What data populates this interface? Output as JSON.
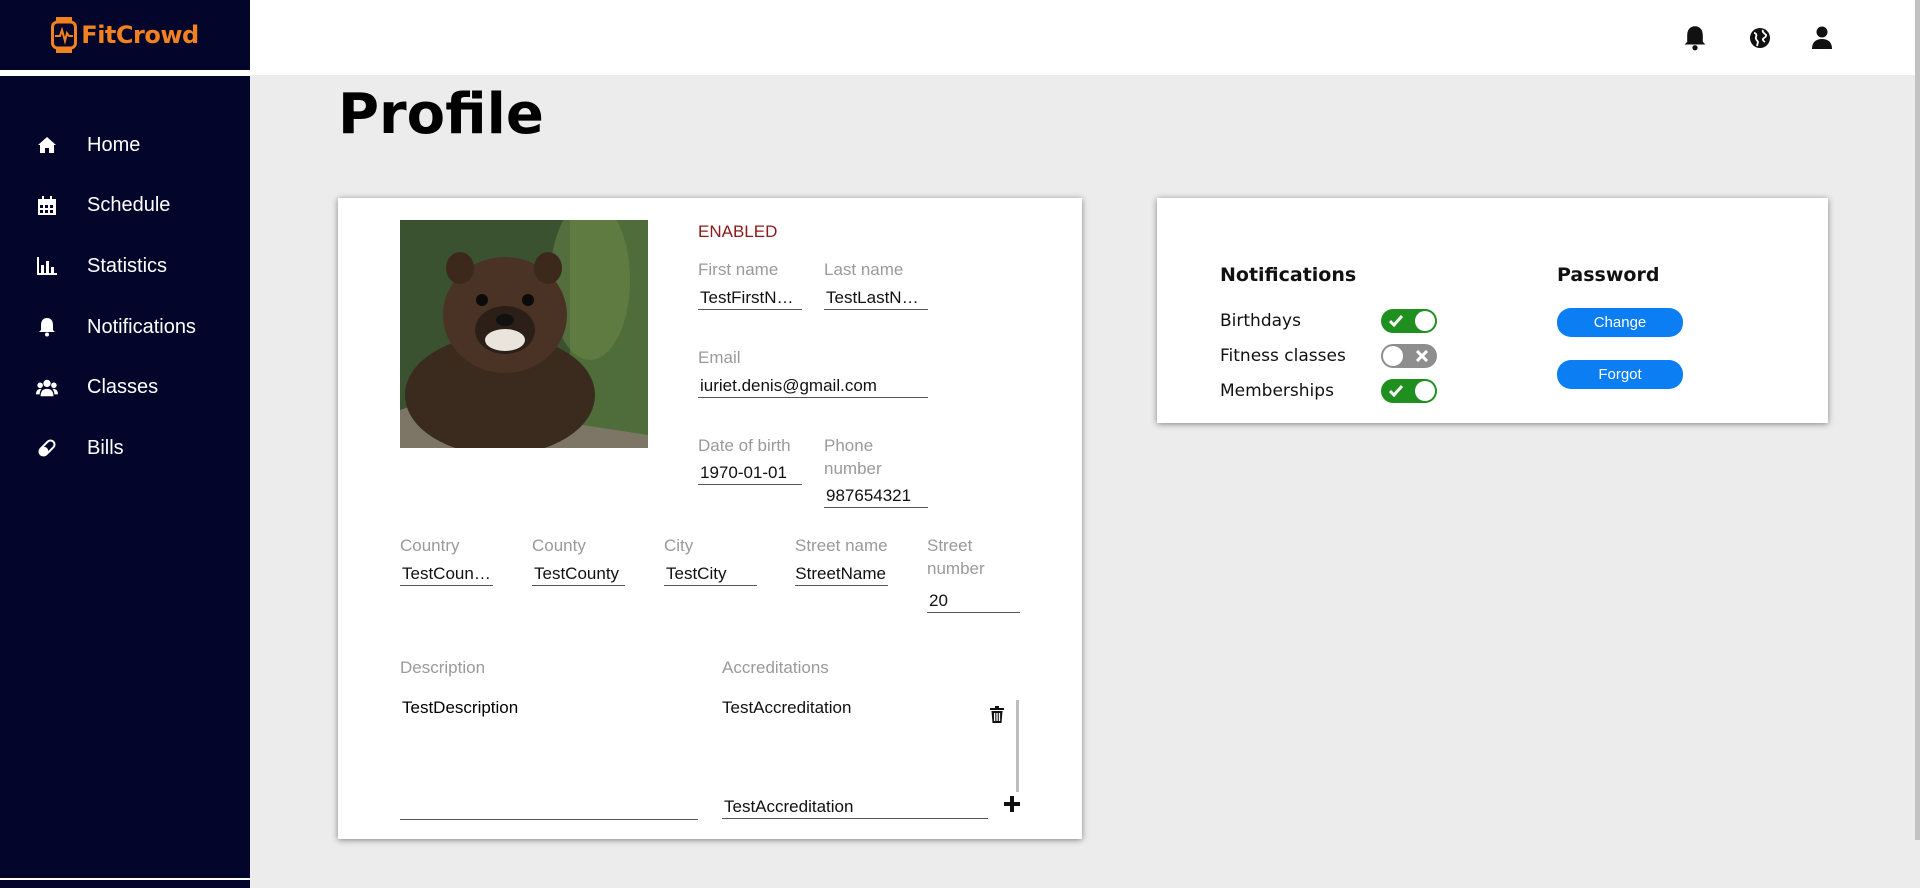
{
  "app": {
    "brand": "FitCrowd",
    "brand_color": "#f28220"
  },
  "sidebar": {
    "items": [
      {
        "label": "Home",
        "icon": "home-icon"
      },
      {
        "label": "Schedule",
        "icon": "calendar-icon"
      },
      {
        "label": "Statistics",
        "icon": "bar-chart-icon"
      },
      {
        "label": "Notifications",
        "icon": "bell-icon"
      },
      {
        "label": "Classes",
        "icon": "users-icon"
      },
      {
        "label": "Bills",
        "icon": "pill-icon"
      }
    ]
  },
  "topbar": {
    "icons": [
      "bell-icon",
      "globe-icon",
      "user-icon"
    ]
  },
  "page": {
    "title": "Profile"
  },
  "profile": {
    "status": "ENABLED",
    "first_name_label": "First name",
    "first_name": "TestFirstName",
    "last_name_label": "Last name",
    "last_name": "TestLastName",
    "email_label": "Email",
    "email": "iuriet.denis@gmail.com",
    "dob_label": "Date of birth",
    "dob": "1970-01-01",
    "phone_label": "Phone number",
    "phone": "987654321",
    "country_label": "Country",
    "country": "TestCountry",
    "county_label": "County",
    "county": "TestCounty",
    "city_label": "City",
    "city": "TestCity",
    "street_name_label": "Street name",
    "street_name": "StreetName",
    "street_number_label": "Street number",
    "street_number": "20",
    "description_label": "Description",
    "description": "TestDescription",
    "accreditations_label": "Accreditations",
    "accreditations": [
      "TestAccreditation"
    ],
    "new_accreditation": "TestAccreditation"
  },
  "settings": {
    "notifications_title": "Notifications",
    "toggles": [
      {
        "label": "Birthdays",
        "on": true
      },
      {
        "label": "Fitness classes",
        "on": false
      },
      {
        "label": "Memberships",
        "on": true
      }
    ],
    "password_title": "Password",
    "change_label": "Change",
    "forgot_label": "Forgot"
  },
  "colors": {
    "sidebar": "#03052a",
    "toggle_on": "#1f8f1f",
    "toggle_off": "#8e8e8e",
    "button": "#0a7ef2",
    "status": "#8b1a1a"
  }
}
